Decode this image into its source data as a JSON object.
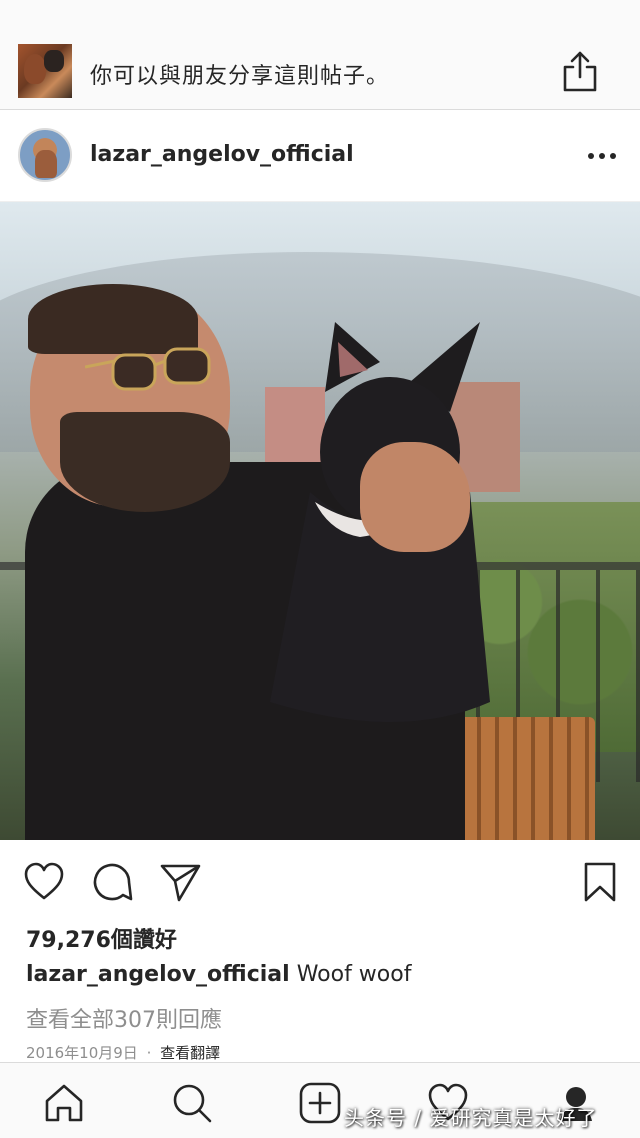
{
  "share_bar": {
    "text": "你可以與朋友分享這則帖子。",
    "share_icon": "share-upload-icon"
  },
  "post": {
    "username": "lazar_angelov_official",
    "more_icon": "more-horizontal-icon",
    "photo_alt": "photo",
    "likes": "79,276個讚好",
    "caption_user": "lazar_angelov_official",
    "caption_text": "Woof woof",
    "view_comments": "查看全部307則回應",
    "date": "2016年10月9日",
    "separator": "·",
    "translate": "查看翻譯"
  },
  "actions": {
    "like_icon": "heart-icon",
    "comment_icon": "comment-icon",
    "share_icon": "paper-plane-icon",
    "save_icon": "bookmark-icon"
  },
  "tabbar": {
    "items": [
      "home-icon",
      "search-icon",
      "add-post-icon",
      "activity-heart-icon",
      "profile-icon"
    ]
  },
  "watermark": "头条号 / 爱研究真是太好了",
  "colors": {
    "text": "#262626",
    "secondary": "#8e8e8e",
    "border": "#dbdbdb",
    "bar_bg": "#fafafa"
  }
}
